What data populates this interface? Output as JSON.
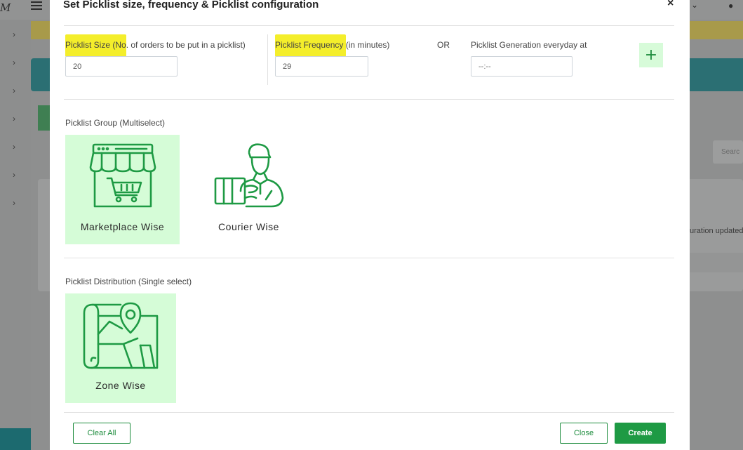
{
  "background": {
    "logo_text": "M",
    "search_placeholder": "Searc",
    "status_message": "uration updated"
  },
  "modal": {
    "title": "Set Picklist size, frequency & Picklist configuration",
    "close_glyph": "×",
    "size_field": {
      "label_highlight": "Picklist Size (No",
      "label_rest": ". of orders to be put in a picklist)",
      "value": "20"
    },
    "frequency_field": {
      "label_highlight": "Picklist Frequency ",
      "label_rest": "(in minutes)",
      "value": "29"
    },
    "or_text": "OR",
    "generation_field": {
      "label": "Picklist Generation everyday at",
      "placeholder": "--:--"
    },
    "add_button_glyph": "+",
    "group_section": {
      "label": "Picklist Group (Multiselect)",
      "options": [
        {
          "label": "Marketplace Wise",
          "selected": true,
          "icon": "marketplace-store-icon"
        },
        {
          "label": "Courier Wise",
          "selected": false,
          "icon": "courier-person-icon"
        }
      ]
    },
    "distribution_section": {
      "label": "Picklist Distribution (Single select)",
      "options": [
        {
          "label": "Zone Wise",
          "selected": true,
          "icon": "zone-map-icon"
        }
      ]
    },
    "footer": {
      "clear_label": "Clear All",
      "close_label": "Close",
      "create_label": "Create"
    }
  },
  "colors": {
    "accent_green": "#1e9a44",
    "selected_card_bg": "#d5fcd7",
    "highlight_yellow": "#f4ee2b",
    "overlay_gray": "#8e8f8f"
  }
}
